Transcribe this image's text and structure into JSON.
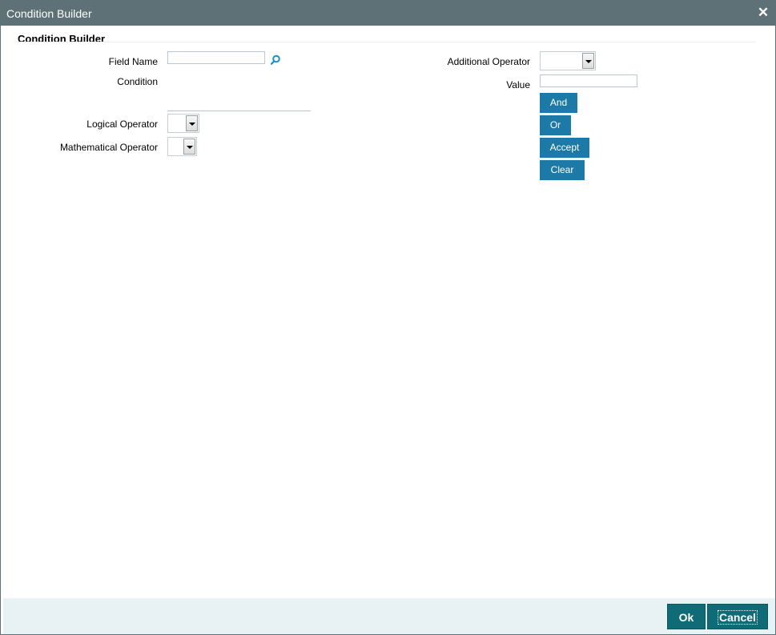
{
  "window": {
    "title": "Condition Builder"
  },
  "section": {
    "title": "Condition Builder"
  },
  "form": {
    "field_name_label": "Field Name",
    "field_name_value": "",
    "condition_label": "Condition",
    "condition_value": "",
    "logical_operator_label": "Logical Operator",
    "logical_operator_value": "",
    "mathematical_operator_label": "Mathematical Operator",
    "mathematical_operator_value": "",
    "additional_operator_label": "Additional Operator",
    "additional_operator_value": "",
    "value_label": "Value",
    "value_value": ""
  },
  "buttons": {
    "and": "And",
    "or": "Or",
    "accept": "Accept",
    "clear": "Clear"
  },
  "footer": {
    "ok": "Ok",
    "cancel": "Cancel"
  },
  "icons": {
    "close": "close-icon",
    "lookup": "search-icon",
    "dropdown": "chevron-down-icon"
  },
  "colors": {
    "titlebar": "#5d7177",
    "button": "#1d7aa6",
    "footer_button": "#0f6b75",
    "footer_bg": "#e8f1f3"
  }
}
